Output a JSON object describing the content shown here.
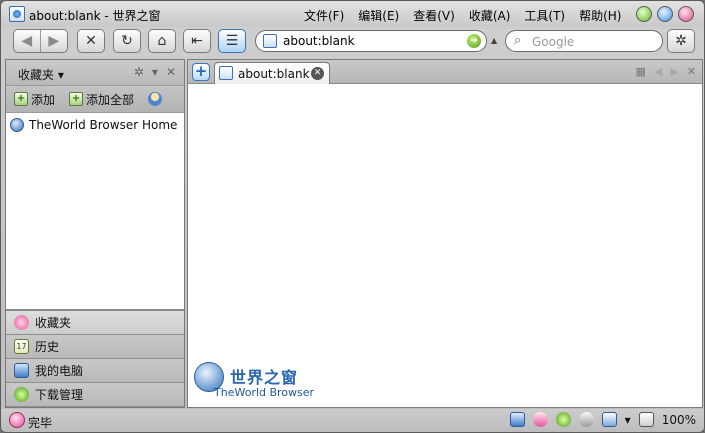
{
  "window": {
    "title": "about:blank - 世界之窗",
    "menu": [
      "文件(F)",
      "编辑(E)",
      "查看(V)",
      "收藏(A)",
      "工具(T)",
      "帮助(H)"
    ]
  },
  "toolbar": {
    "back_icon": "arrow-left-icon",
    "forward_icon": "arrow-right-icon",
    "stop_icon": "stop-icon",
    "refresh_icon": "refresh-icon",
    "home_icon": "home-icon",
    "return_icon": "return-icon",
    "sidebar_toggle_icon": "menu-icon",
    "address_value": "about:blank",
    "search_placeholder": "Google",
    "plugin_icon": "bug-icon"
  },
  "sidebar": {
    "title": "收藏夹",
    "actions": {
      "add": "添加",
      "add_all": "添加全部"
    },
    "bookmarks": [
      "TheWorld Browser Home"
    ],
    "panels": [
      "收藏夹",
      "历史",
      "我的电脑",
      "下载管理"
    ],
    "selected_panel": "收藏夹",
    "calendar_day": "17"
  },
  "tabs": [
    {
      "label": "about:blank",
      "active": true
    }
  ],
  "brand": {
    "name_cn": "世界之窗",
    "name_en": "TheWorld Browser"
  },
  "status": {
    "text": "完毕",
    "zoom": "100%"
  },
  "colors": {
    "accent": "#3774b8",
    "frame": "#c6c6c6"
  }
}
